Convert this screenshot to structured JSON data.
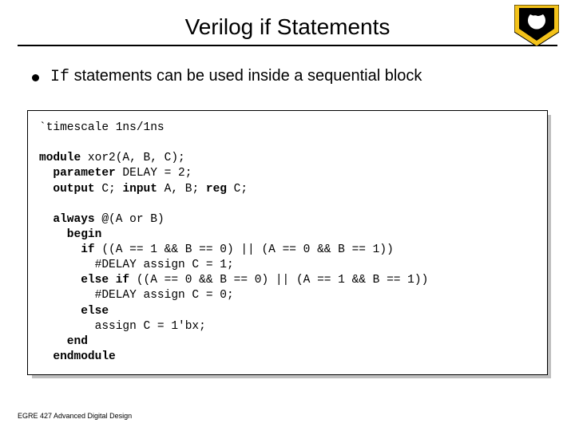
{
  "title": "Verilog if Statements",
  "bullet": {
    "code_word": "If",
    "rest": " statements can be used inside a sequential block"
  },
  "code": {
    "l1": "`timescale 1ns/1ns",
    "l2": "",
    "l3a": "module",
    "l3b": " xor2(A, B, C);",
    "l4a": "  parameter",
    "l4b": " DELAY = 2;",
    "l5a": "  output",
    "l5b": " C; ",
    "l5c": "input",
    "l5d": " A, B; ",
    "l5e": "reg",
    "l5f": " C;",
    "l6": "",
    "l7a": "  always",
    "l7b": " @(A or B)",
    "l8": "    begin",
    "l9a": "      if",
    "l9b": " ((A == 1 && B == 0) || (A == 0 && B == 1))",
    "l10": "        #DELAY assign C = 1;",
    "l11a": "      else if",
    "l11b": " ((A == 0 && B == 0) || (A == 1 && B == 1))",
    "l12": "        #DELAY assign C = 0;",
    "l13": "      else",
    "l14": "        assign C = 1'bx;",
    "l15": "    end",
    "l16": "  endmodule"
  },
  "footer": "EGRE 427 Advanced Digital Design"
}
